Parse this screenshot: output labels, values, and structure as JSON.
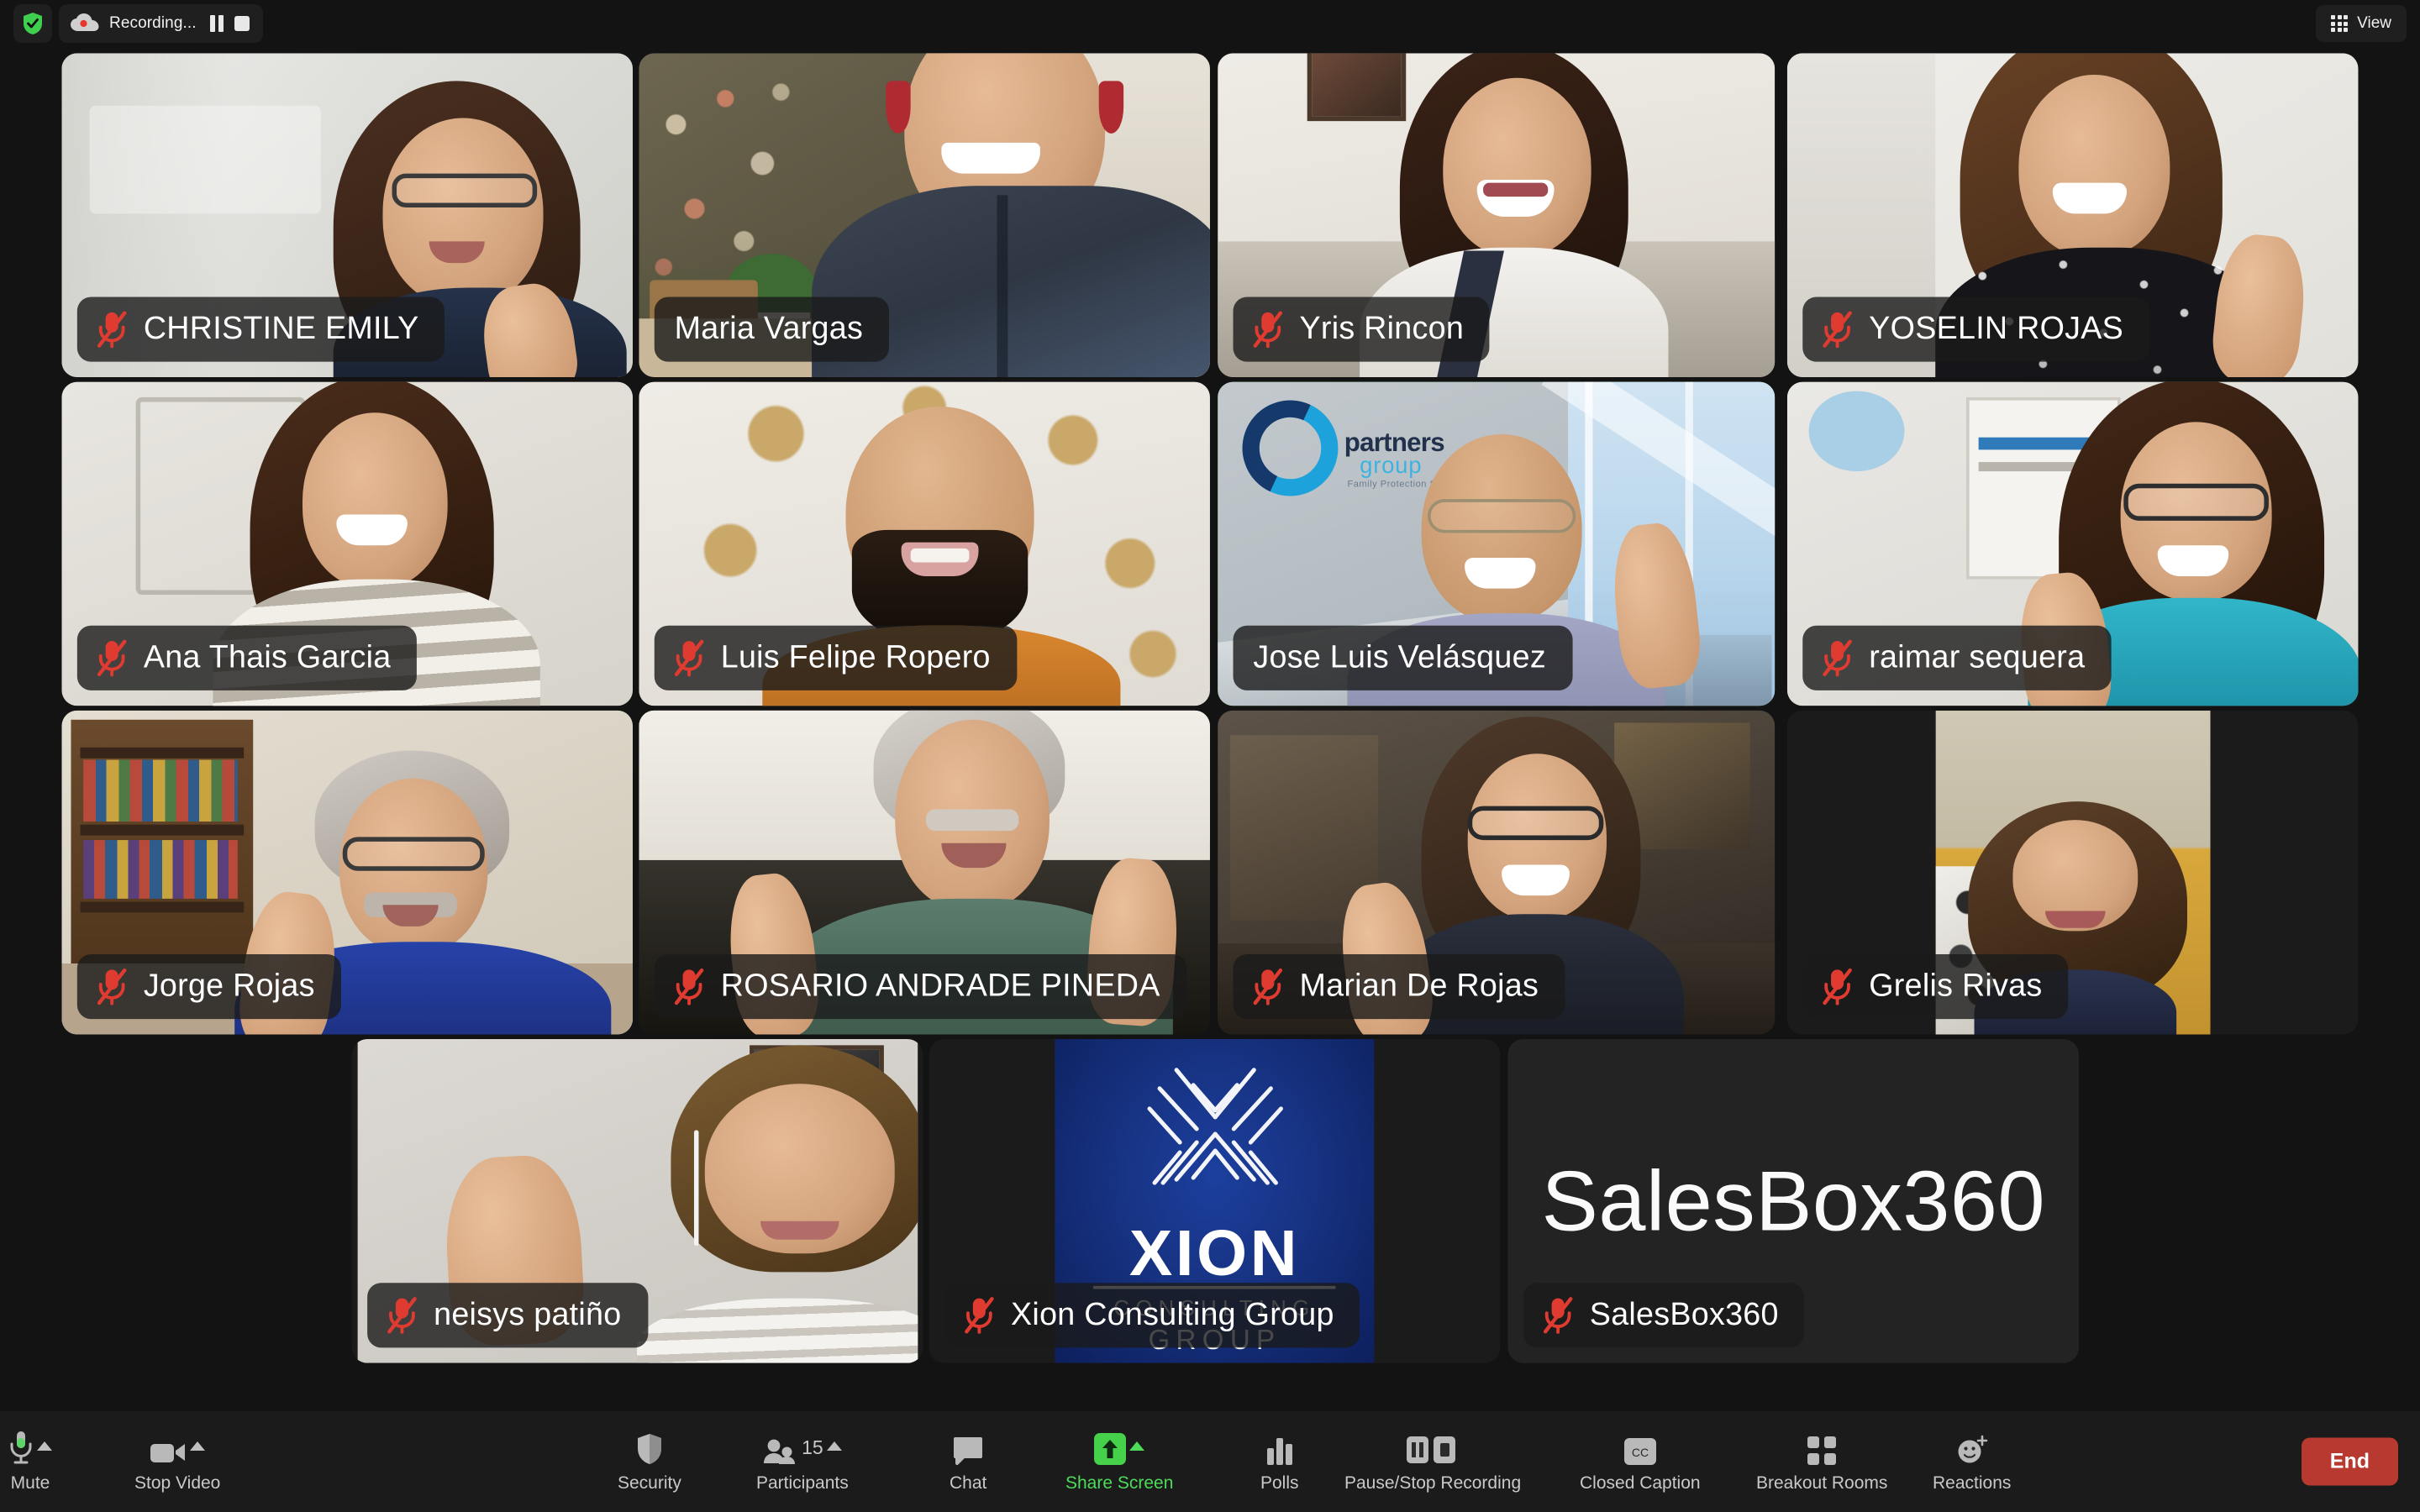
{
  "app": "Zoom Meeting",
  "topbar": {
    "encryption_icon": "shield-check-icon",
    "recording_icon": "cloud-record-icon",
    "recording_label": "Recording...",
    "pause_icon": "pause-icon",
    "stop_icon": "stop-icon",
    "view_icon": "grid-view-icon",
    "view_label": "View"
  },
  "colors": {
    "active_speaker_border": "#46d14b",
    "share_screen_green": "#4ddb5a",
    "end_button_red": "#b8392f",
    "mute_red": "#e03b30",
    "page_background": "#131313",
    "toolbar_background": "#1b1b1b"
  },
  "gallery": {
    "participant_tiles": [
      {
        "name": "CHRISTINE EMILY",
        "muted": true,
        "active_speaker": false,
        "video_on": true,
        "portrait": false
      },
      {
        "name": "Maria Vargas",
        "muted": false,
        "active_speaker": false,
        "video_on": true,
        "portrait": false
      },
      {
        "name": "Yris Rincon",
        "muted": true,
        "active_speaker": false,
        "video_on": true,
        "portrait": false
      },
      {
        "name": "YOSELIN ROJAS",
        "muted": true,
        "active_speaker": false,
        "video_on": true,
        "portrait": false
      },
      {
        "name": "Ana Thais Garcia",
        "muted": true,
        "active_speaker": false,
        "video_on": true,
        "portrait": false
      },
      {
        "name": "Luis Felipe Ropero",
        "muted": true,
        "active_speaker": false,
        "video_on": true,
        "portrait": false
      },
      {
        "name": "Jose Luis Velásquez",
        "muted": false,
        "active_speaker": true,
        "video_on": true,
        "portrait": false
      },
      {
        "name": "raimar sequera",
        "muted": true,
        "active_speaker": false,
        "video_on": true,
        "portrait": false
      },
      {
        "name": "Jorge Rojas",
        "muted": true,
        "active_speaker": false,
        "video_on": true,
        "portrait": false
      },
      {
        "name": "ROSARIO ANDRADE PINEDA",
        "muted": true,
        "active_speaker": false,
        "video_on": true,
        "portrait": false
      },
      {
        "name": "Marian De Rojas",
        "muted": true,
        "active_speaker": false,
        "video_on": true,
        "portrait": false
      },
      {
        "name": "Grelis Rivas",
        "muted": true,
        "active_speaker": false,
        "video_on": true,
        "portrait": true
      },
      {
        "name": "neisys patiño",
        "muted": true,
        "active_speaker": false,
        "video_on": true,
        "portrait": true
      },
      {
        "name": "Xion Consulting Group",
        "muted": true,
        "active_speaker": false,
        "video_on": true,
        "portrait": true
      },
      {
        "name": "SalesBox360",
        "muted": true,
        "active_speaker": false,
        "video_on": false,
        "portrait": false,
        "placeholder_text": "SalesBox360"
      }
    ],
    "branding": {
      "xion_title": "XION",
      "xion_line2": "CONSULTING",
      "xion_line3": "GROUP",
      "partners_group_name": "partners",
      "partners_group_sub": "group",
      "partners_group_tagline": "Family Protection Solutions"
    }
  },
  "toolbar": {
    "items": [
      {
        "icon": "microphone-icon",
        "label": "Mute",
        "caret": true,
        "highlight": false
      },
      {
        "icon": "video-camera-icon",
        "label": "Stop Video",
        "caret": true,
        "highlight": false
      },
      {
        "icon": "shield-icon",
        "label": "Security",
        "caret": false,
        "highlight": false
      },
      {
        "icon": "participants-icon",
        "label": "Participants",
        "caret": true,
        "highlight": false,
        "badge": "15"
      },
      {
        "icon": "chat-bubble-icon",
        "label": "Chat",
        "caret": false,
        "highlight": false
      },
      {
        "icon": "share-screen-icon",
        "label": "Share Screen",
        "caret": true,
        "highlight": true
      },
      {
        "icon": "polls-bars-icon",
        "label": "Polls",
        "caret": false,
        "highlight": false
      },
      {
        "icon": "pause-stop-rec-icon",
        "label": "Pause/Stop Recording",
        "caret": false,
        "highlight": false
      },
      {
        "icon": "closed-caption-icon",
        "label": "Closed Caption",
        "caret": false,
        "highlight": false
      },
      {
        "icon": "breakout-rooms-icon",
        "label": "Breakout Rooms",
        "caret": false,
        "highlight": false
      },
      {
        "icon": "reactions-icon",
        "label": "Reactions",
        "caret": false,
        "highlight": false
      }
    ],
    "participants_count": "15",
    "end_label": "End"
  }
}
